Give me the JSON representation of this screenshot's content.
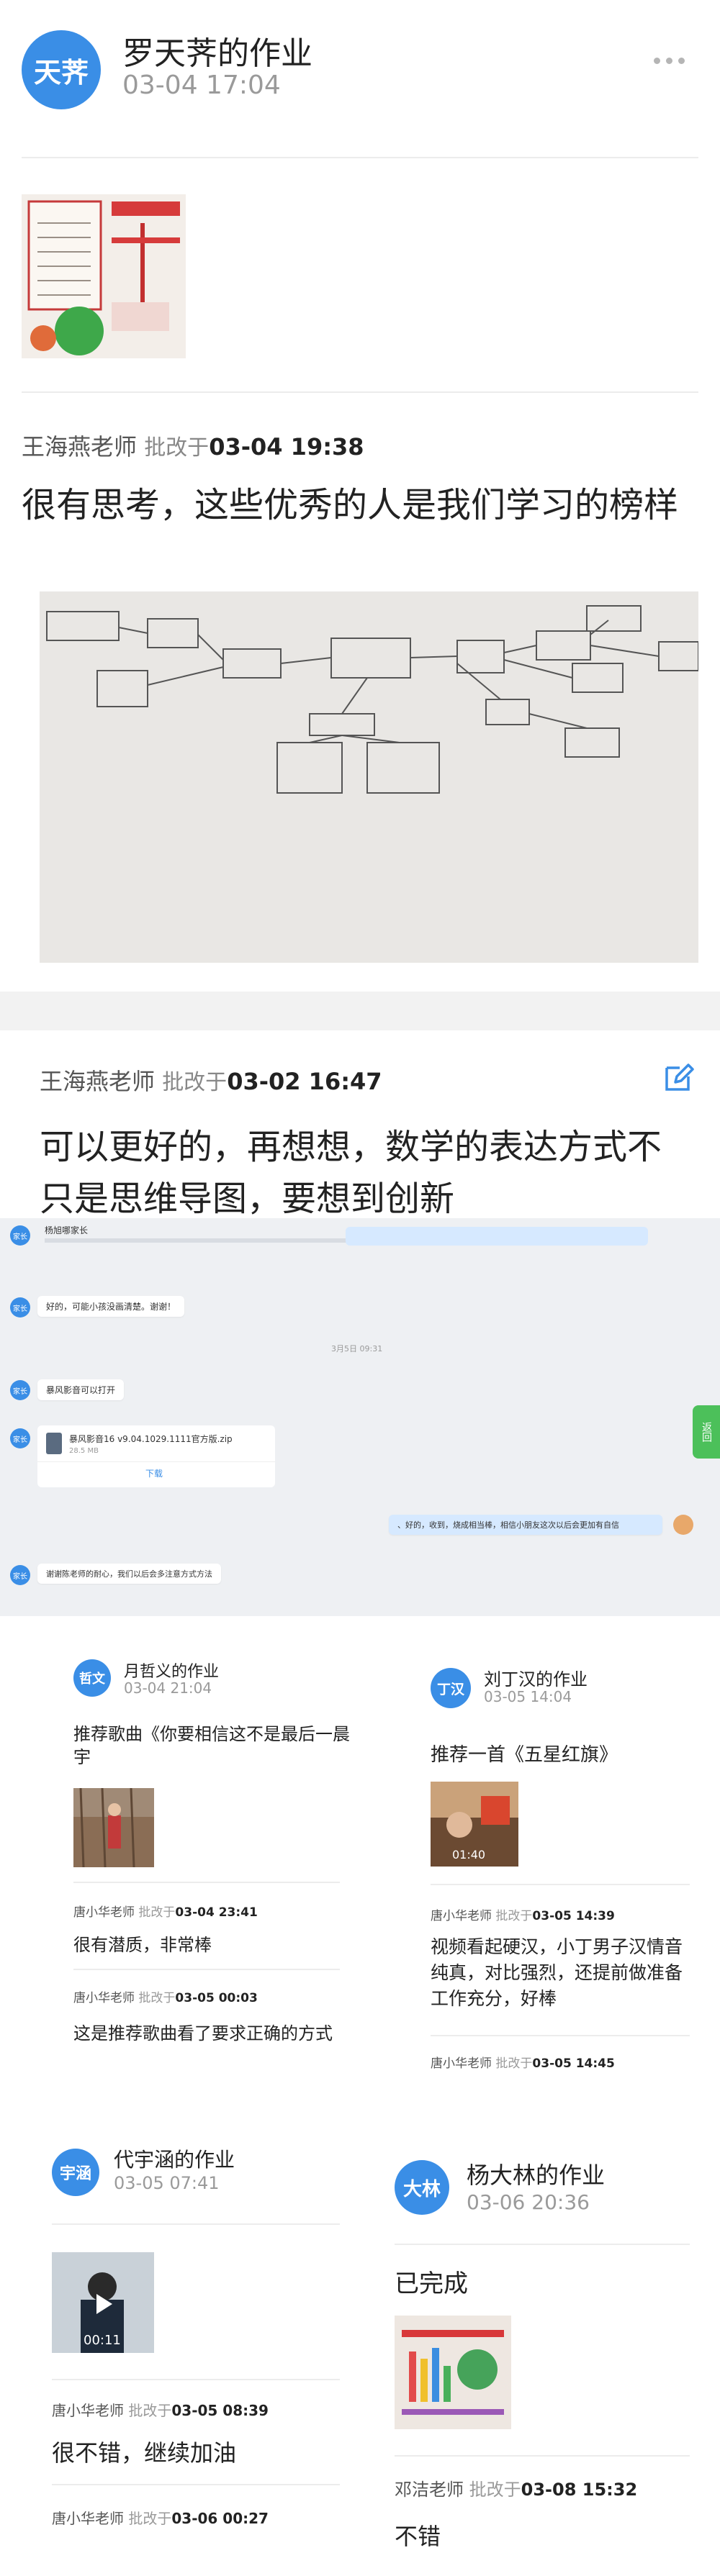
{
  "post": {
    "avatar": "天荠",
    "title": "罗天荠的作业",
    "time": "03-04 17:04",
    "more_icon": "ellipsis-icon"
  },
  "comment1": {
    "teacher": "王海燕老师",
    "action": "批改于",
    "time": "03-04 19:38",
    "text": "很有思考，这些优秀的人是我们学习的榜样"
  },
  "comment2": {
    "teacher": "王海燕老师",
    "action": "批改于",
    "time": "03-02 16:47",
    "edit_icon": "edit-icon",
    "text": "可以更好的，再想想，数学的表达方式不只是思维导图，要想到创新"
  },
  "chat": {
    "header_name": "杨旭哪家长",
    "messages": [
      {
        "avatar": "家长",
        "text": "好的，可能小孩没画清楚。谢谢！"
      },
      {
        "avatar": "家长",
        "text": "暴风影音可以打开"
      },
      {
        "avatar": "家长",
        "text": "谢谢陈老师的耐心，我们以后会多注意方式方法"
      }
    ],
    "center_time": "3月5日 09:31",
    "file_name": "暴风影音16 v9.04.1029.1111官方版.zip",
    "file_size": "28.5 MB",
    "download_label": "下载",
    "reply_right": "、好的，收到，烧成相当棒，相信小朋友这次以后会更加有自信",
    "side_tab": "返回"
  },
  "card_a": {
    "avatar": "哲文",
    "title": "月哲义的作业",
    "time": "03-04 21:04",
    "text": "推荐歌曲《你要相信这不是最后一晨宇",
    "c1_teacher": "唐小华老师",
    "c1_action": "批改于",
    "c1_time": "03-04 23:41",
    "c1_text": "很有潜质，非常棒",
    "c2_teacher": "唐小华老师",
    "c2_action": "批改于",
    "c2_time": "03-05 00:03",
    "c2_text": "这是推荐歌曲看了要求正确的方式"
  },
  "card_b": {
    "avatar": "丁汉",
    "title": "刘丁汉的作业",
    "time": "03-05 14:04",
    "text": "推荐一首《五星红旗》",
    "video_duration": "01:40",
    "c1_teacher": "唐小华老师",
    "c1_action": "批改于",
    "c1_time": "03-05 14:39",
    "c1_text": "视频看起硬汉，小丁男子汉情音纯真，对比强烈，还提前做准备工作充分，好棒",
    "c2_teacher": "唐小华老师",
    "c2_action": "批改于",
    "c2_time": "03-05 14:45"
  },
  "card_c": {
    "avatar": "宇涵",
    "title": "代宇涵的作业",
    "time": "03-05 07:41",
    "video_duration": "00:11",
    "c1_teacher": "唐小华老师",
    "c1_action": "批改于",
    "c1_time": "03-05 08:39",
    "c1_text": "很不错，继续加油",
    "c2_teacher": "唐小华老师",
    "c2_action": "批改于",
    "c2_time": "03-06 00:27"
  },
  "card_d": {
    "avatar": "大林",
    "title": "杨大林的作业",
    "time": "03-06 20:36",
    "text": "已完成",
    "c1_teacher": "邓洁老师",
    "c1_action": "批改于",
    "c1_time": "03-08 15:32",
    "c1_text": "不错"
  },
  "colors": {
    "accent": "#3a8ee6",
    "page_bg": "#ffffff",
    "card_bg": "#f5f5f5"
  }
}
